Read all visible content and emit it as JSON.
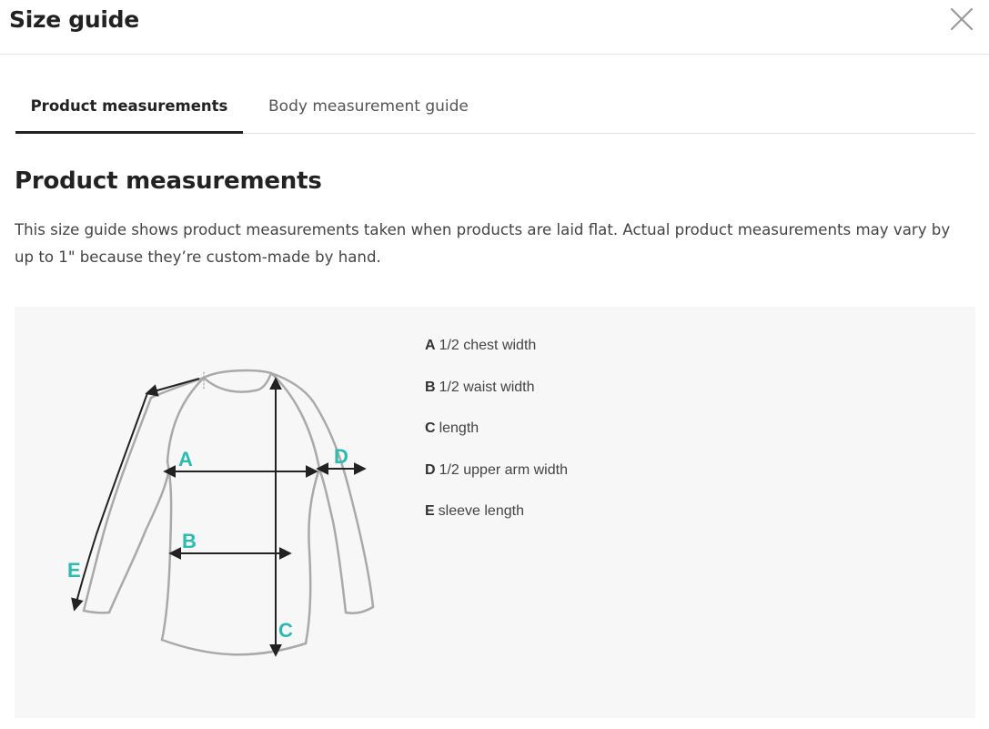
{
  "modal": {
    "title": "Size guide",
    "close_icon": "close-icon"
  },
  "tabs": [
    {
      "label": "Product measurements",
      "active": true
    },
    {
      "label": "Body measurement guide",
      "active": false
    }
  ],
  "content": {
    "heading": "Product measurements",
    "description": "This size guide shows product measurements taken when products are laid flat. Actual product measurements may vary by up to 1\" because they’re custom-made by hand."
  },
  "diagram": {
    "markers": {
      "A": "A",
      "B": "B",
      "C": "C",
      "D": "D",
      "E": "E"
    },
    "marker_color": "#2bbbb0",
    "outline_color": "#a9a9a9",
    "arrow_color": "#222222"
  },
  "legend": [
    {
      "letter": "A",
      "text": "1/2 chest width"
    },
    {
      "letter": "B",
      "text": "1/2 waist width"
    },
    {
      "letter": "C",
      "text": "length"
    },
    {
      "letter": "D",
      "text": "1/2 upper arm width"
    },
    {
      "letter": "E",
      "text": "sleeve length"
    }
  ],
  "colors": {
    "panel_background": "#f7f7f7",
    "text_primary": "#222222",
    "text_secondary": "#444444",
    "divider": "#e4e4e4"
  }
}
